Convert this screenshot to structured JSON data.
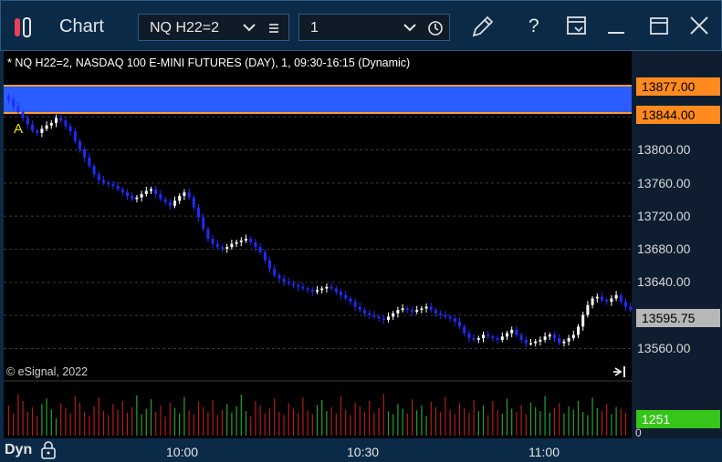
{
  "window": {
    "title": "Chart",
    "symbol": "NQ H22=2",
    "interval": "1",
    "icons": [
      "app-logo-icon",
      "chevron-down-icon",
      "list-icon",
      "clock-icon",
      "pencil-icon",
      "help-icon",
      "layout-icon",
      "minimize-icon",
      "maximize-icon",
      "close-icon"
    ],
    "help_glyph": "?"
  },
  "chart": {
    "info_line": "* NQ H22=2, NASDAQ 100 E-MINI FUTURES (DAY), 1, 09:30-16:15 (Dynamic)",
    "watermark": "© eSignal, 2022",
    "marker_label": "A",
    "price_labels": [
      "13800.00",
      "13760.00",
      "13720.00",
      "13680.00",
      "13640.00",
      "13560.00"
    ],
    "badges": {
      "upper_band": "13877.00",
      "lower_band": "13844.00",
      "last_price": "13595.75",
      "volume": "1251",
      "volume_zero": "0"
    },
    "time_labels": [
      "10:00",
      "10:30",
      "11:00"
    ],
    "mode_label": "Dyn",
    "colors": {
      "band": "#2a5cff",
      "band_border": "#ff9a2e",
      "badge_orange": "#ff8a1e",
      "last_price_badge": "#b7b7b7",
      "volume_badge": "#36c51a",
      "candle_up": "#ffffff",
      "candle_down": "#1f2bff",
      "vol_up": "#25a52d",
      "vol_down": "#b51c1c"
    }
  },
  "chart_data": {
    "type": "candlestick",
    "ylim": [
      13530,
      13890
    ],
    "y_ticks": [
      13560,
      13600,
      13640,
      13680,
      13720,
      13760,
      13800,
      13840
    ],
    "x_tick_labels": [
      "10:00",
      "10:30",
      "11:00"
    ],
    "band": {
      "low": 13844.0,
      "high": 13877.0
    },
    "close": [
      13860,
      13852,
      13845,
      13838,
      13830,
      13823,
      13820,
      13825,
      13829,
      13832,
      13838,
      13835,
      13828,
      13822,
      13810,
      13800,
      13790,
      13780,
      13770,
      13763,
      13760,
      13758,
      13756,
      13752,
      13748,
      13744,
      13740,
      13742,
      13746,
      13750,
      13752,
      13746,
      13740,
      13736,
      13732,
      13738,
      13744,
      13748,
      13742,
      13730,
      13718,
      13704,
      13692,
      13686,
      13682,
      13680,
      13682,
      13686,
      13688,
      13690,
      13692,
      13688,
      13682,
      13676,
      13666,
      13656,
      13648,
      13644,
      13640,
      13638,
      13636,
      13634,
      13632,
      13630,
      13628,
      13630,
      13632,
      13634,
      13632,
      13628,
      13624,
      13620,
      13616,
      13610,
      13606,
      13602,
      13600,
      13598,
      13596,
      13594,
      13598,
      13602,
      13606,
      13608,
      13606,
      13604,
      13606,
      13608,
      13610,
      13606,
      13602,
      13600,
      13598,
      13596,
      13592,
      13586,
      13578,
      13572,
      13570,
      13572,
      13576,
      13574,
      13572,
      13570,
      13574,
      13578,
      13582,
      13576,
      13570,
      13566,
      13566,
      13568,
      13570,
      13574,
      13576,
      13572,
      13566,
      13568,
      13572,
      13576,
      13586,
      13600,
      13612,
      13620,
      13622,
      13618,
      13616,
      13620,
      13624,
      13616,
      13610,
      13606
    ],
    "volume": [
      38,
      28,
      52,
      44,
      30,
      36,
      25,
      40,
      47,
      33,
      22,
      41,
      35,
      28,
      50,
      42,
      30,
      25,
      37,
      48,
      31,
      26,
      40,
      33,
      44,
      29,
      36,
      51,
      27,
      34,
      46,
      30,
      38,
      24,
      42,
      35,
      28,
      49,
      32,
      27,
      43,
      36,
      30,
      45,
      26,
      33,
      40,
      29,
      37,
      52,
      31,
      25,
      44,
      38,
      28,
      35,
      47,
      30,
      26,
      41,
      34,
      29,
      48,
      32,
      27,
      39,
      45,
      31,
      36,
      28,
      50,
      33,
      26,
      42,
      37,
      30,
      44,
      29,
      35,
      53,
      31,
      27,
      40,
      34,
      28,
      46,
      32,
      38,
      25,
      43,
      36,
      30,
      49,
      33,
      27,
      41,
      35,
      29,
      45,
      31,
      38,
      26,
      44,
      32,
      28,
      47,
      34,
      30,
      39,
      27,
      42,
      36,
      31,
      50,
      29,
      35,
      41,
      28,
      37,
      33,
      44,
      30,
      26,
      48,
      35,
      31,
      40,
      27,
      36,
      34,
      29
    ]
  }
}
